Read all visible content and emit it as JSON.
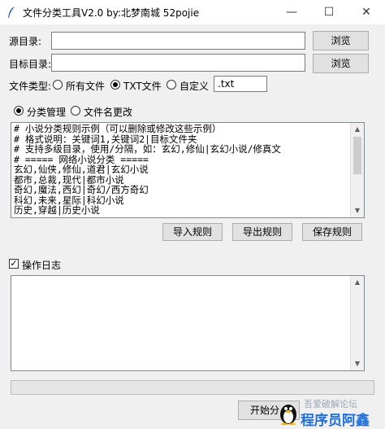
{
  "window": {
    "title": "文件分类工具V2.0  by:北梦南城 52pojie"
  },
  "source": {
    "label": "源目录:",
    "value": "",
    "browse_label": "浏览"
  },
  "target": {
    "label": "目标目录:",
    "value": "",
    "browse_label": "浏览"
  },
  "file_type": {
    "label": "文件类型:",
    "options": [
      "所有文件",
      "TXT文件",
      "自定义"
    ],
    "selected": "TXT文件",
    "custom_value": ".txt"
  },
  "mode": {
    "options": [
      "分类管理",
      "文件名更改"
    ],
    "selected": "分类管理"
  },
  "rules": {
    "lines": [
      "# 小说分类规则示例（可以删除或修改这些示例）",
      "# 格式说明：关键词1,关键词2|目标文件夹",
      "# 支持多级目录，使用/分隔，如：玄幻,修仙|玄幻小说/修真文",
      "",
      "# ===== 网络小说分类 =====",
      "玄幻,仙侠,修仙,道君|玄幻小说",
      "都市,总裁,现代|都市小说",
      "奇幻,魔法,西幻|奇幻/西方奇幻",
      "科幻,未来,星际|科幻小说",
      "历史,穿越|历史小说"
    ],
    "import_label": "导入规则",
    "export_label": "导出规则",
    "save_label": "保存规则"
  },
  "log": {
    "label": "操作日志",
    "checked": true,
    "text": ""
  },
  "actions": {
    "start_label": "开始分"
  },
  "watermark": {
    "line1": "吾爱破解论坛",
    "line2": "程序员阿鑫"
  }
}
